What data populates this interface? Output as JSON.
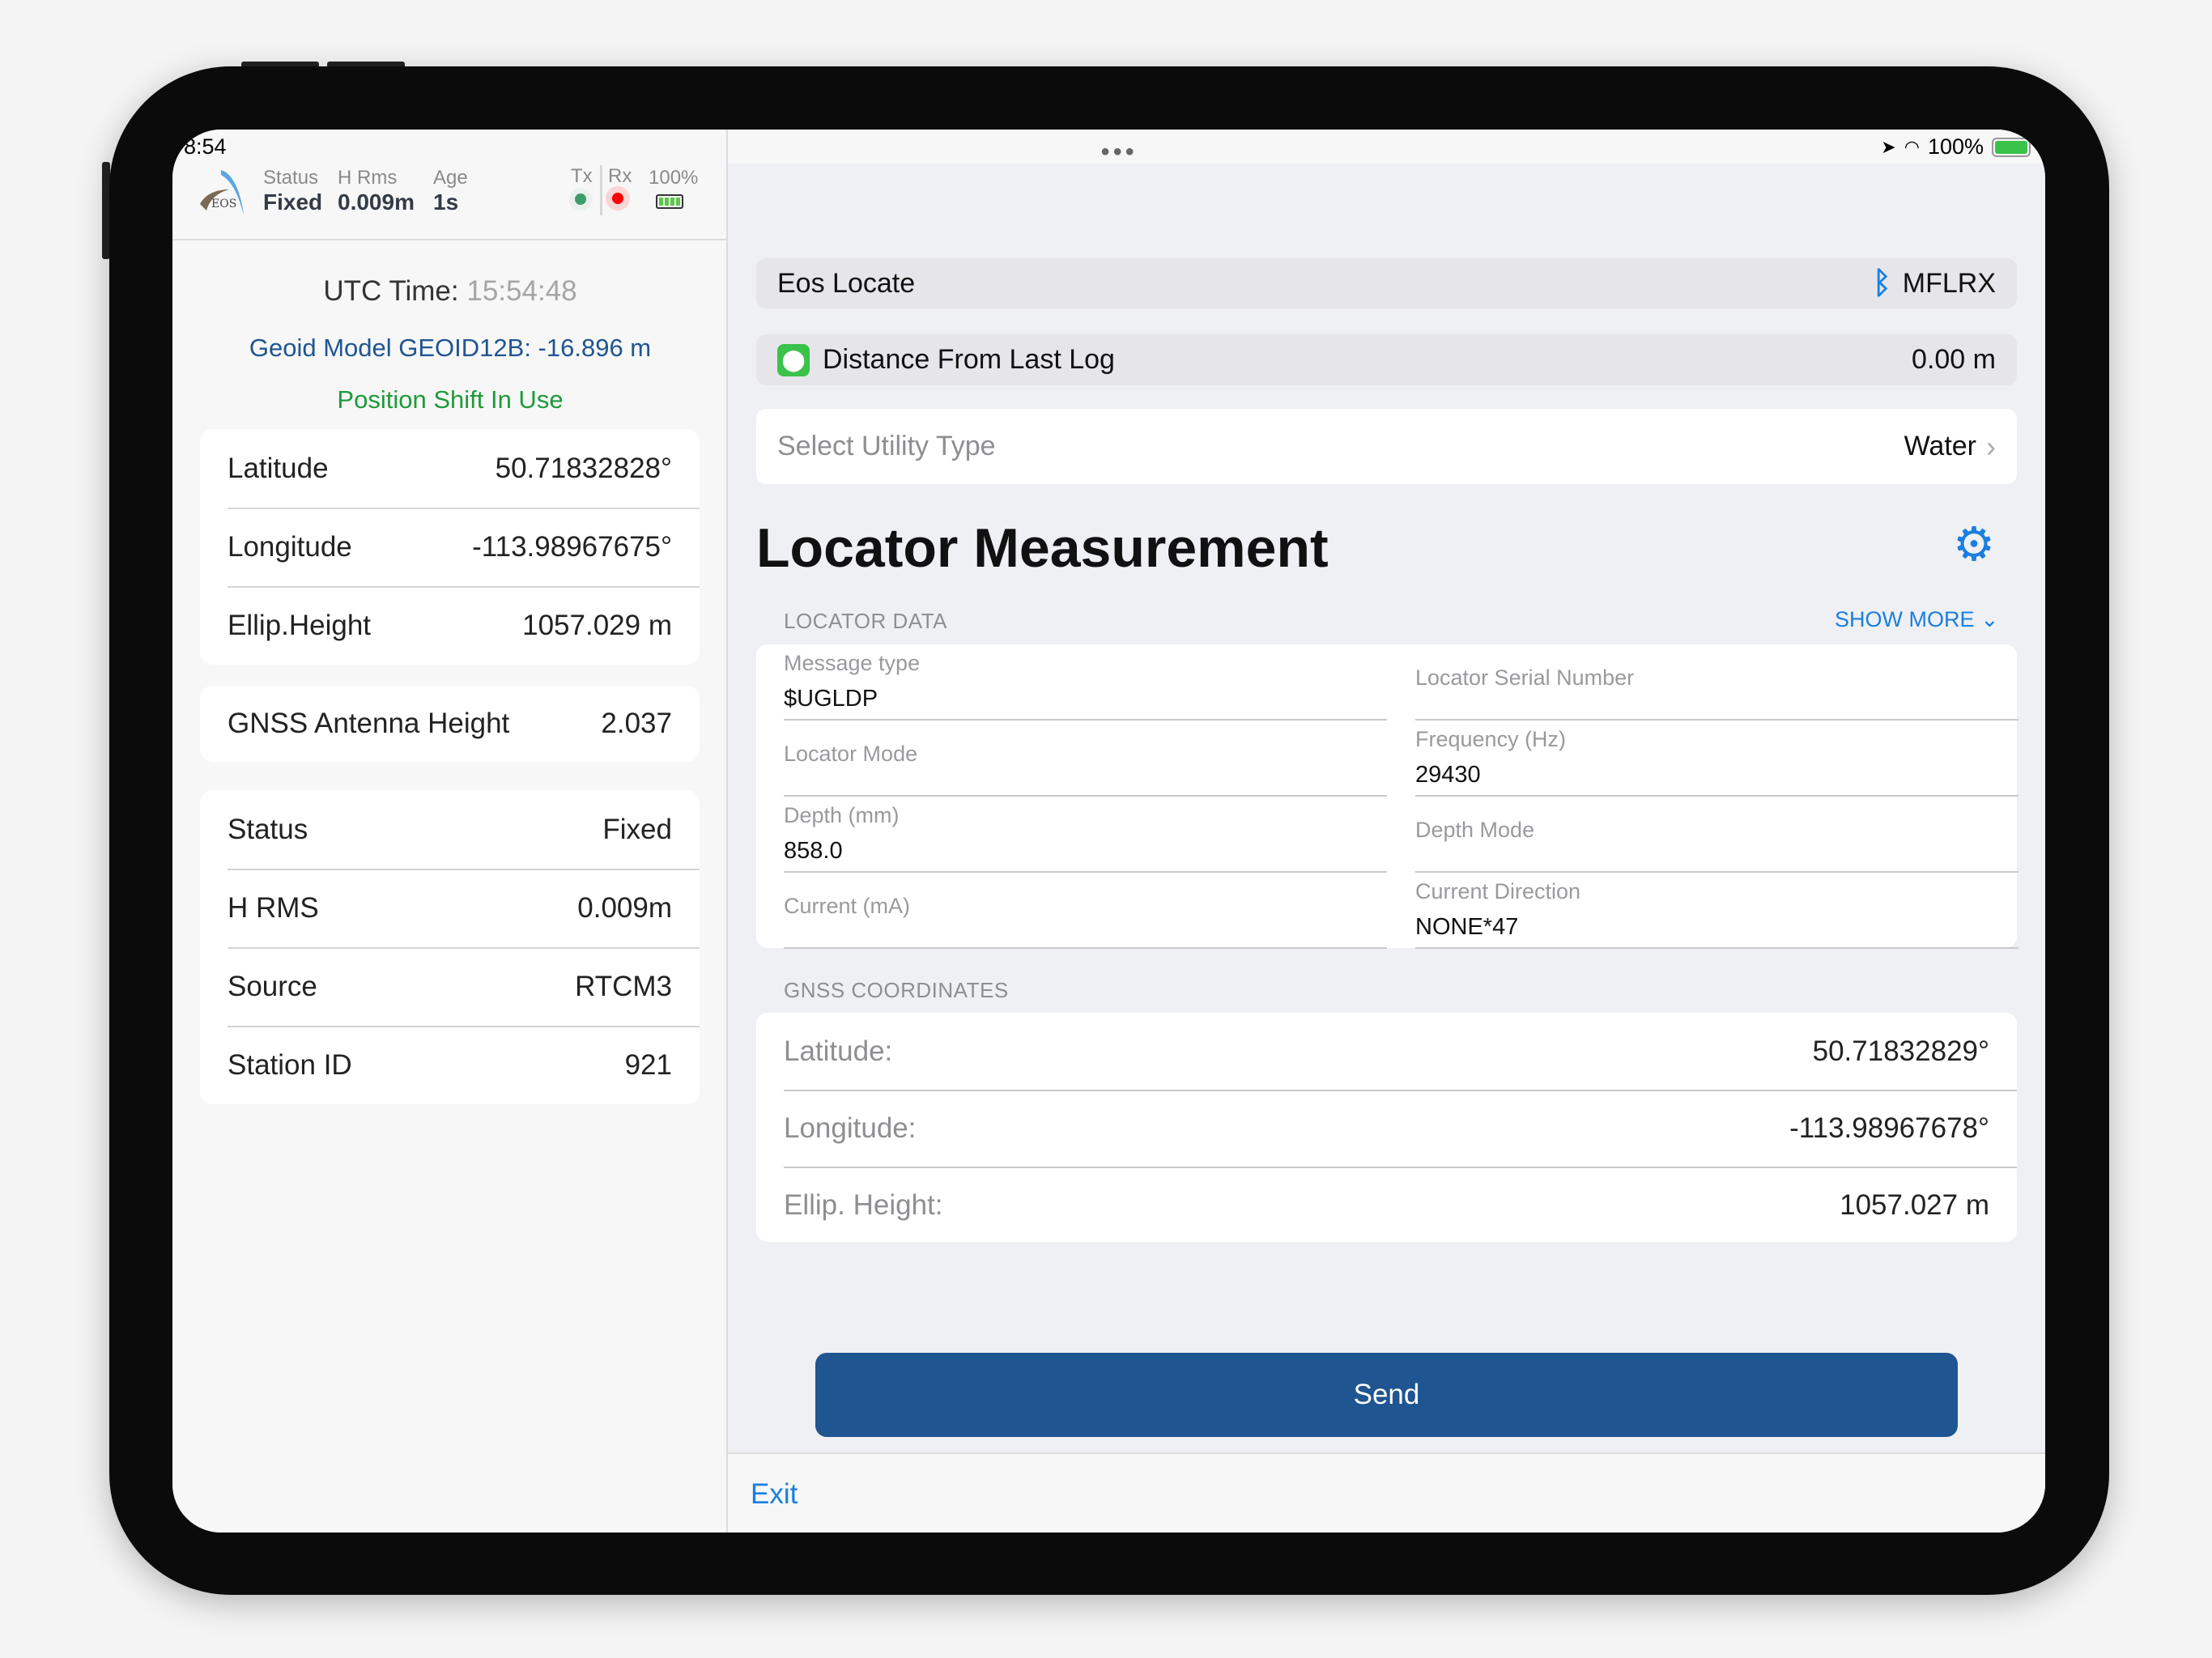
{
  "status_bar": {
    "time": "8:54",
    "battery": "100%"
  },
  "gnss_header": {
    "status_label": "Status",
    "status_value": "Fixed",
    "hrms_label": "H Rms",
    "hrms_value": "0.009m",
    "age_label": "Age",
    "age_value": "1s",
    "tx_label": "Tx",
    "rx_label": "Rx",
    "battery": "100%",
    "logo_text": "EOS"
  },
  "left": {
    "utc_label": "UTC Time:",
    "utc_value": "15:54:48",
    "geoid": "Geoid Model GEOID12B: -16.896 m",
    "position_shift": "Position Shift In Use",
    "position": [
      {
        "label": "Latitude",
        "value": "50.71832828°"
      },
      {
        "label": "Longitude",
        "value": "-113.98967675°"
      },
      {
        "label": "Ellip.Height",
        "value": "1057.029 m"
      }
    ],
    "antenna": {
      "label": "GNSS Antenna Height",
      "value": "2.037"
    },
    "info": [
      {
        "label": "Status",
        "value": "Fixed"
      },
      {
        "label": "H RMS",
        "value": "0.009m"
      },
      {
        "label": "Source",
        "value": "RTCM3"
      },
      {
        "label": "Station ID",
        "value": "921"
      }
    ]
  },
  "right": {
    "device_name": "Eos Locate",
    "receiver": "MFLRX",
    "distance_label": "Distance From Last Log",
    "distance_value": "0.00 m",
    "utility_label": "Select Utility Type",
    "utility_value": "Water",
    "title": "Locator Measurement",
    "locator_section": "LOCATOR DATA",
    "show_more": "SHOW MORE",
    "fields": [
      {
        "label": "Message type",
        "value": "$UGLDP"
      },
      {
        "label": "Locator Serial Number",
        "value": ""
      },
      {
        "label": "Locator Mode",
        "value": ""
      },
      {
        "label": "Frequency (Hz)",
        "value": "29430"
      },
      {
        "label": "Depth (mm)",
        "value": "858.0"
      },
      {
        "label": "Depth Mode",
        "value": ""
      },
      {
        "label": "Current (mA)",
        "value": ""
      },
      {
        "label": "Current Direction",
        "value": "NONE*47"
      }
    ],
    "gnss_section": "GNSS COORDINATES",
    "coords": [
      {
        "label": "Latitude:",
        "value": "50.71832829°"
      },
      {
        "label": "Longitude:",
        "value": "-113.98967678°"
      },
      {
        "label": "Ellip. Height:",
        "value": "1057.027 m"
      }
    ],
    "send": "Send",
    "exit": "Exit"
  },
  "colors": {
    "accent": "#1a7fe0",
    "send": "#1f5591",
    "green": "#1e9a3a",
    "geoid": "#1f5591"
  }
}
